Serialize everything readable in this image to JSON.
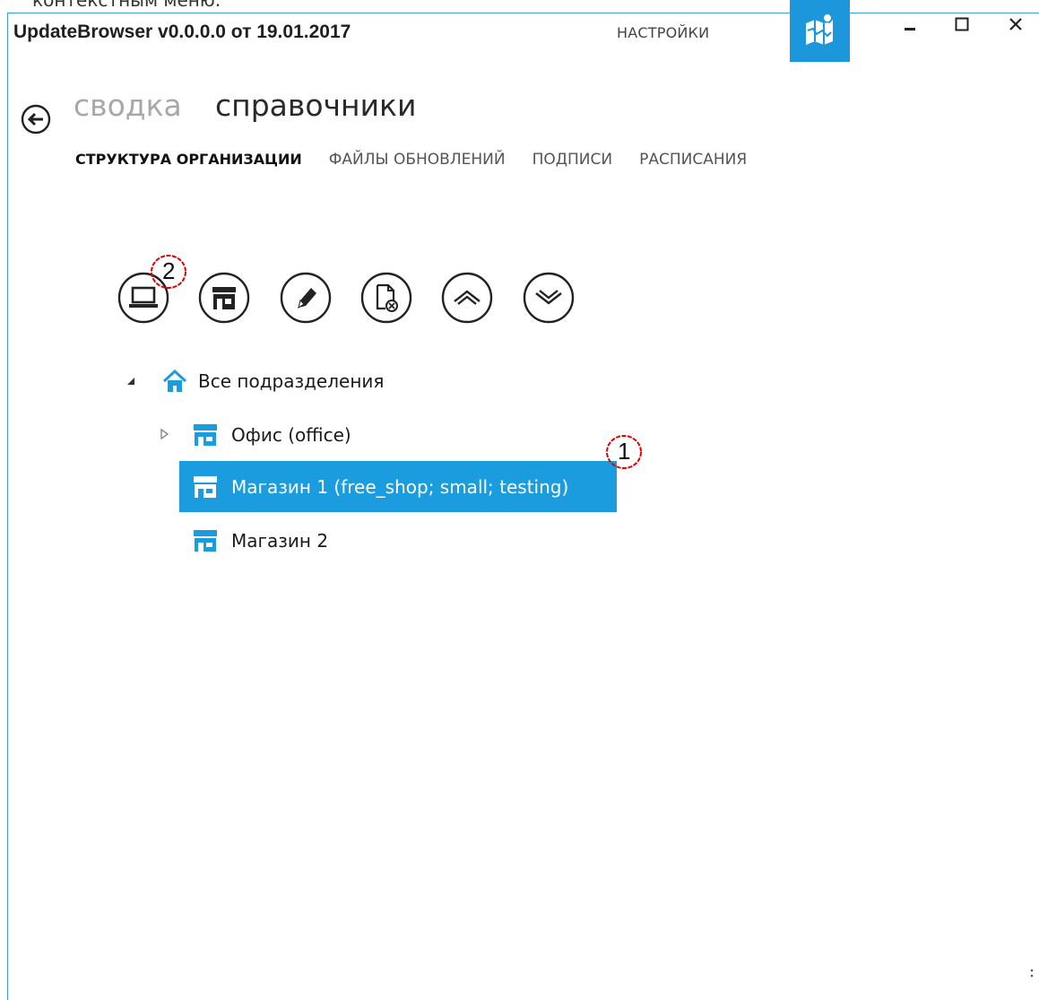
{
  "caption": "контекстным меню.",
  "window": {
    "title": "UpdateBrowser v0.0.0.0 от 19.01.2017",
    "settings_label": "НАСТРОЙКИ",
    "minimize_label": "–",
    "maximize_label": "□",
    "close_label": "✕"
  },
  "breadcrumb": {
    "previous": "сводка",
    "current": "справочники"
  },
  "tabs": [
    {
      "label": "СТРУКТУРА ОРГАНИЗАЦИИ",
      "active": true
    },
    {
      "label": "ФАЙЛЫ ОБНОВЛЕНИЙ",
      "active": false
    },
    {
      "label": "ПОДПИСИ",
      "active": false
    },
    {
      "label": "РАСПИСАНИЯ",
      "active": false
    }
  ],
  "toolbar": [
    {
      "icon": "computer-icon"
    },
    {
      "icon": "store-icon"
    },
    {
      "icon": "pencil-icon"
    },
    {
      "icon": "delete-document-icon"
    },
    {
      "icon": "move-up-icon"
    },
    {
      "icon": "move-down-icon"
    }
  ],
  "tree": {
    "root": {
      "label": "Все подразделения",
      "icon": "home-icon",
      "expanded": true
    },
    "children": [
      {
        "label": "Офис (office)",
        "icon": "store-icon",
        "expandable": true,
        "selected": false
      },
      {
        "label": "Магазин 1 (free_shop; small; testing)",
        "icon": "store-icon",
        "expandable": false,
        "selected": true
      },
      {
        "label": "Магазин 2",
        "icon": "store-icon",
        "expandable": false,
        "selected": false
      }
    ]
  },
  "annotations": [
    {
      "number": "1"
    },
    {
      "number": "2"
    }
  ],
  "colors": {
    "accent": "#1a9cdf",
    "marker_red": "#e00000"
  }
}
